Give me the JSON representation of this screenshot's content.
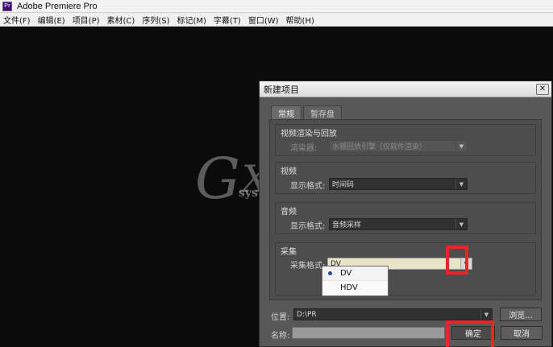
{
  "app": {
    "icon_label": "Pr",
    "title": "Adobe Premiere Pro"
  },
  "menu": [
    "文件(F)",
    "编辑(E)",
    "项目(P)",
    "素材(C)",
    "序列(S)",
    "标记(M)",
    "字幕(T)",
    "窗口(W)",
    "帮助(H)"
  ],
  "dialog": {
    "title": "新建项目",
    "close_label": "✕",
    "tabs": [
      "常规",
      "暂存盘"
    ],
    "groups": {
      "video_render": {
        "title": "视频渲染与回放",
        "renderer_label": "渲染器:",
        "renderer_value": "水银回放引擎（仅软件渲染）"
      },
      "video": {
        "title": "视频",
        "format_label": "显示格式:",
        "format_value": "时间码"
      },
      "audio": {
        "title": "音频",
        "format_label": "显示格式:",
        "format_value": "音频采样"
      },
      "capture": {
        "title": "采集",
        "format_label": "采集格式:",
        "format_value": "DV",
        "options": [
          "DV",
          "HDV"
        ]
      }
    },
    "location_label": "位置:",
    "location_value": "D:\\PR",
    "browse_label": "浏览...",
    "name_label": "名称:",
    "name_value": "",
    "ok_label": "确定",
    "cancel_label": "取消"
  },
  "watermark": {
    "text": "system.com"
  },
  "colors": {
    "highlight_box": "#e8262a",
    "dialog_bg": "#585858",
    "app_bg": "#0b0b0b"
  }
}
